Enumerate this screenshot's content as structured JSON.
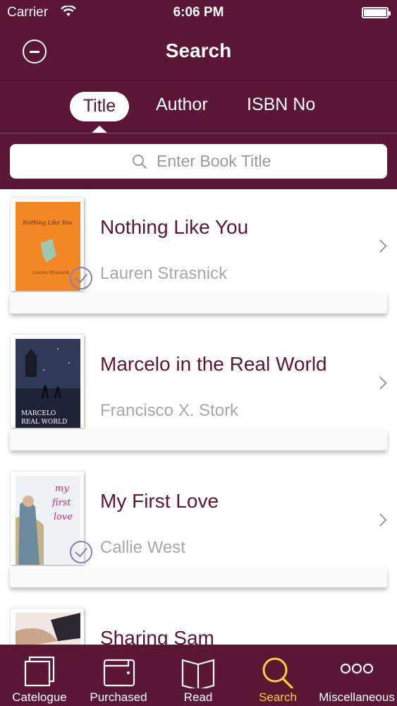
{
  "status_bar": {
    "carrier": "Carrier",
    "time": "6:06 PM"
  },
  "nav": {
    "title": "Search"
  },
  "segments": [
    "Title",
    "Author",
    "ISBN No"
  ],
  "search": {
    "placeholder": "Enter Book Title",
    "value": ""
  },
  "books": [
    {
      "title": "Nothing Like You",
      "author": "Lauren Strasnick",
      "purchased": true,
      "cover_lines": [
        "Nothing Like You"
      ],
      "cover_color": "#f07a1a"
    },
    {
      "title": "Marcelo in the Real World",
      "author": "Francisco X. Stork",
      "purchased": false,
      "cover_lines": [
        "MARCELO",
        "REAL WORLD"
      ],
      "cover_color": "#1f2336"
    },
    {
      "title": "My First Love",
      "author": "Callie West",
      "purchased": true,
      "cover_lines": [
        "my",
        "first",
        "love"
      ],
      "cover_color": "#eef2f5"
    },
    {
      "title": "Sharing Sam",
      "author": "",
      "purchased": false,
      "cover_lines": [],
      "cover_color": "#c9a58a"
    }
  ],
  "tabs": [
    {
      "label": "Catelogue",
      "icon": "catalogue-icon",
      "active": false
    },
    {
      "label": "Purchased",
      "icon": "wallet-icon",
      "active": false
    },
    {
      "label": "Read",
      "icon": "open-book-icon",
      "active": false
    },
    {
      "label": "Search",
      "icon": "search-icon",
      "active": true
    },
    {
      "label": "Miscellaneous",
      "icon": "more-icon",
      "active": false
    }
  ],
  "colors": {
    "brand": "#5a1634",
    "active_tab": "#f5d33a",
    "check": "#8a7cc0"
  }
}
